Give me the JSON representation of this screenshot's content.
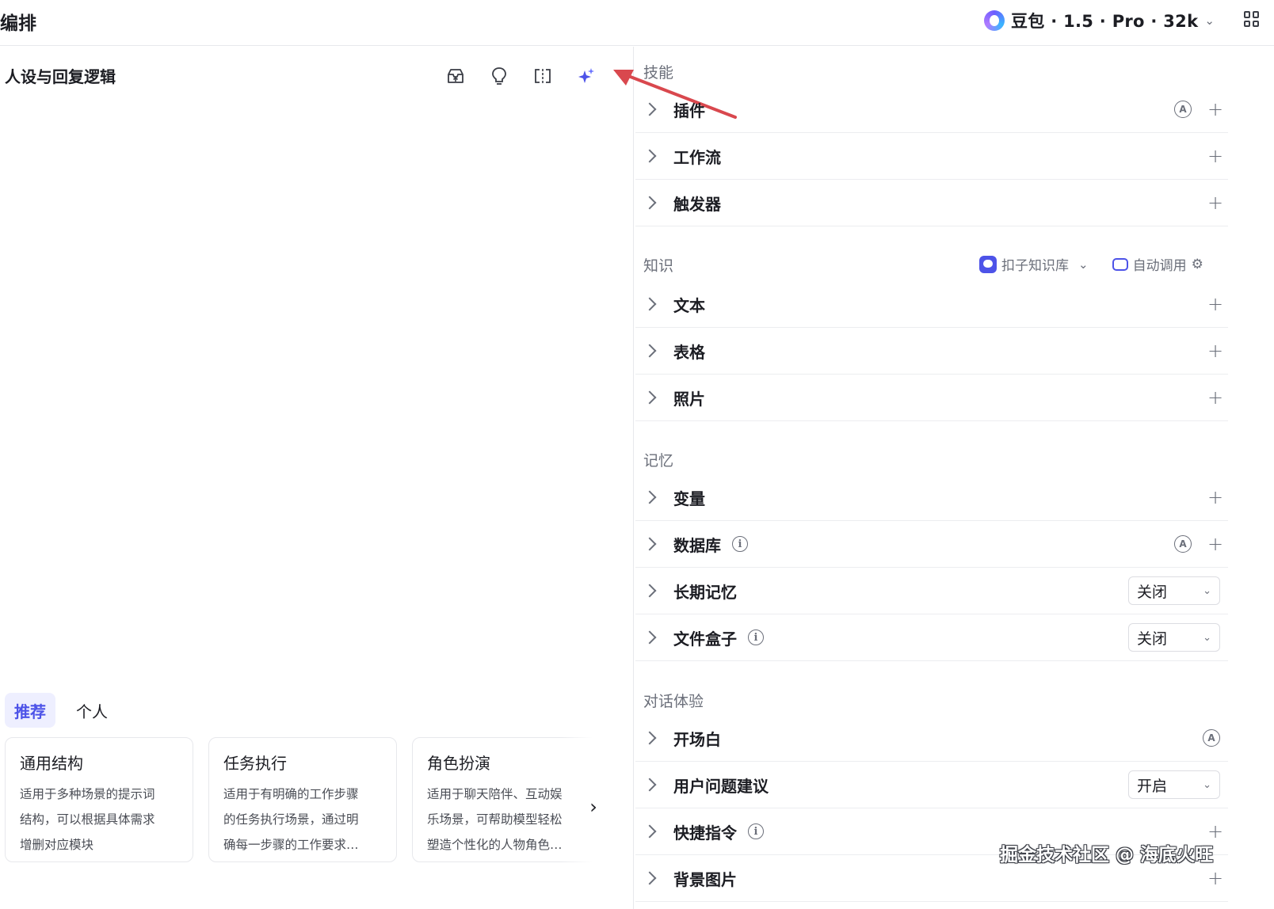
{
  "header": {
    "title": "编排",
    "model": "豆包 · 1.5 · Pro · 32k",
    "layout_icon": "grid-icon"
  },
  "left_panel": {
    "title": "人设与回复逻辑",
    "toolbar_icons": [
      "template-icon",
      "lightbulb-icon",
      "compare-icon",
      "ai-optimize-icon"
    ],
    "accent_color": "#4d53e8",
    "annotation_arrow_color": "#d9484e",
    "tabs": [
      {
        "label": "推荐",
        "active": true
      },
      {
        "label": "个人",
        "active": false
      }
    ],
    "cards": [
      {
        "title": "通用结构",
        "lines": [
          "适用于多种场景的提示词",
          "结构，可以根据具体需求",
          "增删对应模块"
        ]
      },
      {
        "title": "任务执行",
        "lines": [
          "适用于有明确的工作步骤",
          "的任务执行场景，通过明",
          "确每一步骤的工作要求…"
        ]
      },
      {
        "title": "角色扮演",
        "lines": [
          "适用于聊天陪伴、互动娱",
          "乐场景，可帮助模型轻松",
          "塑造个性化的人物角色…"
        ]
      }
    ]
  },
  "right_panel": {
    "sections": {
      "skills": {
        "title": "技能",
        "items": [
          {
            "label": "插件"
          },
          {
            "label": "工作流"
          },
          {
            "label": "触发器"
          }
        ]
      },
      "knowledge": {
        "title": "知识",
        "kb_source": "扣子知识库",
        "invoke_mode": "自动调用",
        "items": [
          {
            "label": "文本"
          },
          {
            "label": "表格"
          },
          {
            "label": "照片"
          }
        ]
      },
      "memory": {
        "title": "记忆",
        "items": [
          {
            "label": "变量"
          },
          {
            "label": "数据库"
          },
          {
            "label": "长期记忆",
            "value": "关闭"
          },
          {
            "label": "文件盒子",
            "value": "关闭"
          }
        ]
      },
      "dialog": {
        "title": "对话体验",
        "items": [
          {
            "label": "开场白"
          },
          {
            "label": "用户问题建议",
            "value": "开启"
          },
          {
            "label": "快捷指令"
          },
          {
            "label": "背景图片"
          }
        ]
      }
    },
    "auto_badge": "A",
    "plus": "+",
    "info": "i"
  },
  "watermark": "掘金技术社区 @ 海底火旺"
}
